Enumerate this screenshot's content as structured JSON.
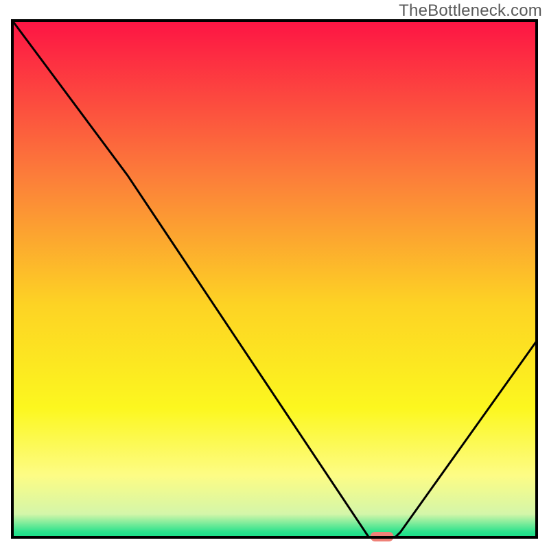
{
  "watermark": "TheBottleneck.com",
  "chart_data": {
    "type": "line",
    "title": "",
    "xlabel": "",
    "ylabel": "",
    "xlim": [
      0,
      100
    ],
    "ylim": [
      0,
      100
    ],
    "series": [
      {
        "name": "bottleneck-curve",
        "x": [
          0,
          22,
          68,
          73,
          74,
          100
        ],
        "values": [
          100,
          70,
          0,
          0,
          1,
          38
        ]
      }
    ],
    "markers": [
      {
        "name": "optimal-point",
        "shape": "rounded-rect",
        "x": 70.5,
        "y": 0,
        "color": "#ef8178"
      }
    ],
    "background_gradient": {
      "stops": [
        {
          "offset": 0.0,
          "color": "#fd1444"
        },
        {
          "offset": 0.3,
          "color": "#fc7d3a"
        },
        {
          "offset": 0.55,
          "color": "#fdd324"
        },
        {
          "offset": 0.75,
          "color": "#fcf71f"
        },
        {
          "offset": 0.88,
          "color": "#fdfc85"
        },
        {
          "offset": 0.955,
          "color": "#d4f6a9"
        },
        {
          "offset": 0.99,
          "color": "#29e28d"
        },
        {
          "offset": 1.0,
          "color": "#1adf89"
        }
      ]
    },
    "frame_color": "#000000"
  }
}
